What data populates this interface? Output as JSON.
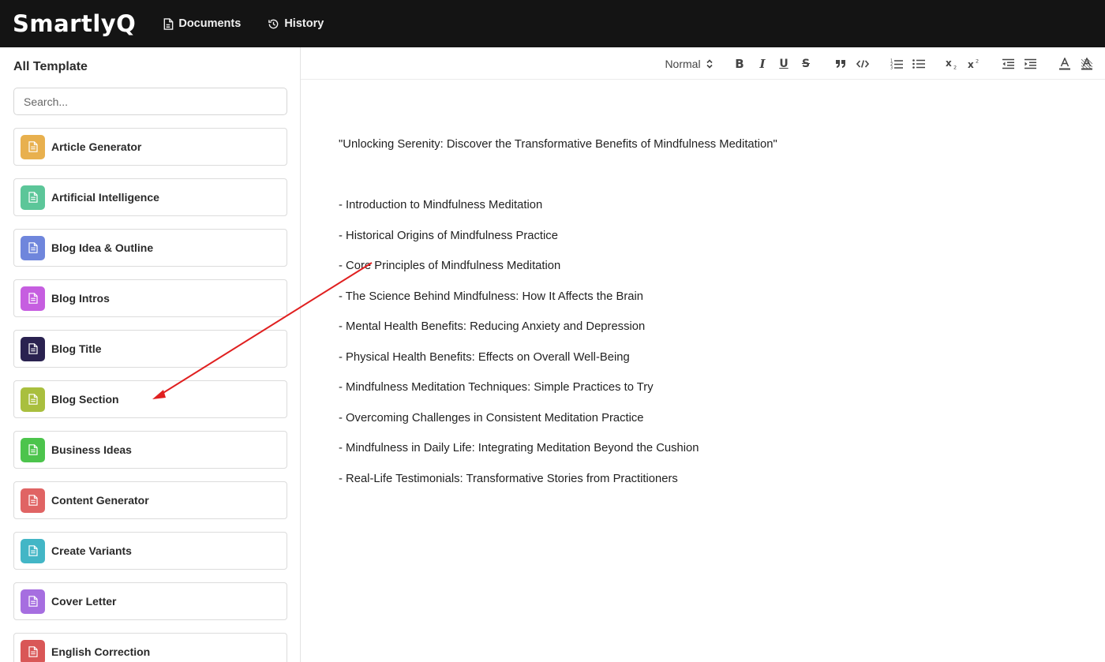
{
  "app": {
    "logo": "SmartlyQ"
  },
  "nav": [
    {
      "label": "Documents",
      "icon": "document-icon"
    },
    {
      "label": "History",
      "icon": "history-icon"
    }
  ],
  "sidebar": {
    "title": "All Template",
    "search_placeholder": "Search...",
    "items": [
      {
        "label": "Article Generator",
        "color": "#e8b04e"
      },
      {
        "label": "Artificial Intelligence",
        "color": "#5cc699"
      },
      {
        "label": "Blog Idea & Outline",
        "color": "#6f86dc"
      },
      {
        "label": "Blog Intros",
        "color": "#c65ee0"
      },
      {
        "label": "Blog Title",
        "color": "#2a2250"
      },
      {
        "label": "Blog Section",
        "color": "#a9bf3e"
      },
      {
        "label": "Business Ideas",
        "color": "#4cc44c"
      },
      {
        "label": "Content Generator",
        "color": "#e06464"
      },
      {
        "label": "Create Variants",
        "color": "#43b6c6"
      },
      {
        "label": "Cover Letter",
        "color": "#a66ee0"
      },
      {
        "label": "English Correction",
        "color": "#d95757"
      }
    ]
  },
  "toolbar": {
    "format_select": "Normal",
    "buttons": [
      "bold",
      "italic",
      "underline",
      "strike",
      "blockquote",
      "code",
      "ordered-list",
      "bullet-list",
      "subscript",
      "superscript",
      "outdent",
      "indent",
      "text-color",
      "background-color"
    ]
  },
  "document": {
    "title_line": "\"Unlocking Serenity: Discover the Transformative Benefits of Mindfulness Meditation\"",
    "outline": [
      "- Introduction to Mindfulness Meditation",
      "- Historical Origins of Mindfulness Practice",
      "- Core Principles of Mindfulness Meditation",
      "- The Science Behind Mindfulness: How It Affects the Brain",
      "- Mental Health Benefits: Reducing Anxiety and Depression",
      "- Physical Health Benefits: Effects on Overall Well-Being",
      "- Mindfulness Meditation Techniques: Simple Practices to Try",
      "- Overcoming Challenges in Consistent Meditation Practice",
      "- Mindfulness in Daily Life: Integrating Meditation Beyond the Cushion",
      "- Real-Life Testimonials: Transformative Stories from Practitioners"
    ]
  },
  "annotation": {
    "color": "#e02020"
  }
}
